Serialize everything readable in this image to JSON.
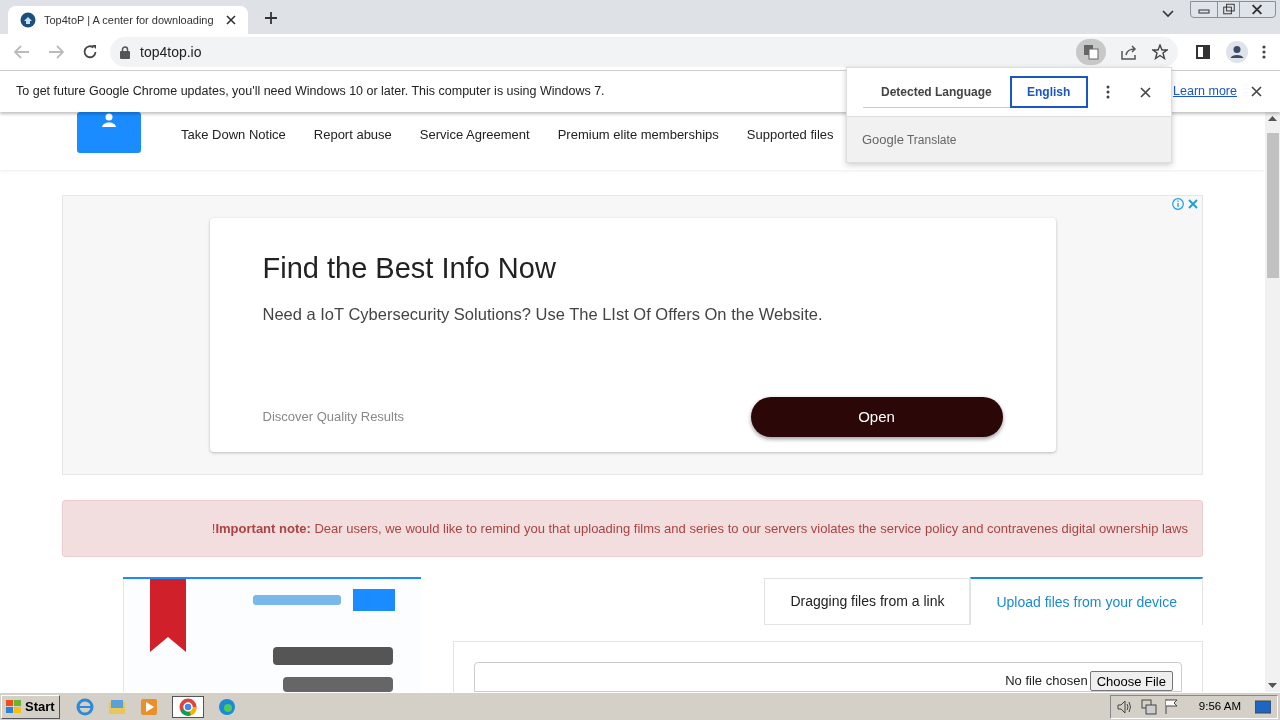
{
  "browser": {
    "tab": {
      "title": "Top4toP | A center for downloading",
      "selected": true
    },
    "address": "top4top.io"
  },
  "infobar": {
    "message": "To get future Google Chrome updates, you'll need Windows 10 or later. This computer is using Windows 7.",
    "link": "Learn more"
  },
  "translate_popup": {
    "languages": [
      {
        "label": "Detected Language",
        "selected": false
      },
      {
        "label": "English",
        "selected": true
      }
    ],
    "brand": "Google",
    "product": "Translate"
  },
  "nav": {
    "items": [
      "Take Down Notice",
      "Report abuse",
      "Service Agreement",
      "Premium elite memberships",
      "Supported files"
    ]
  },
  "ad": {
    "headline": "Find the Best Info Now",
    "text": "Need a IoT Cybersecurity Solutions? Use The LIst Of Offers On the Website.",
    "source": "Discover Quality Results",
    "button": "Open"
  },
  "alert": {
    "text": "!**Important note:** Dear users, we would like to remind you that uploading films and series to our servers violates the service policy and contravenes digital ownership laws"
  },
  "upload": {
    "tabs": [
      {
        "label": "Dragging files from a link",
        "selected": false
      },
      {
        "label": "Upload files from your device",
        "selected": true
      }
    ],
    "file_status": "No file chosen",
    "choose_button": "Choose File"
  },
  "taskbar": {
    "start": "Start",
    "time": "9:56 AM"
  }
}
